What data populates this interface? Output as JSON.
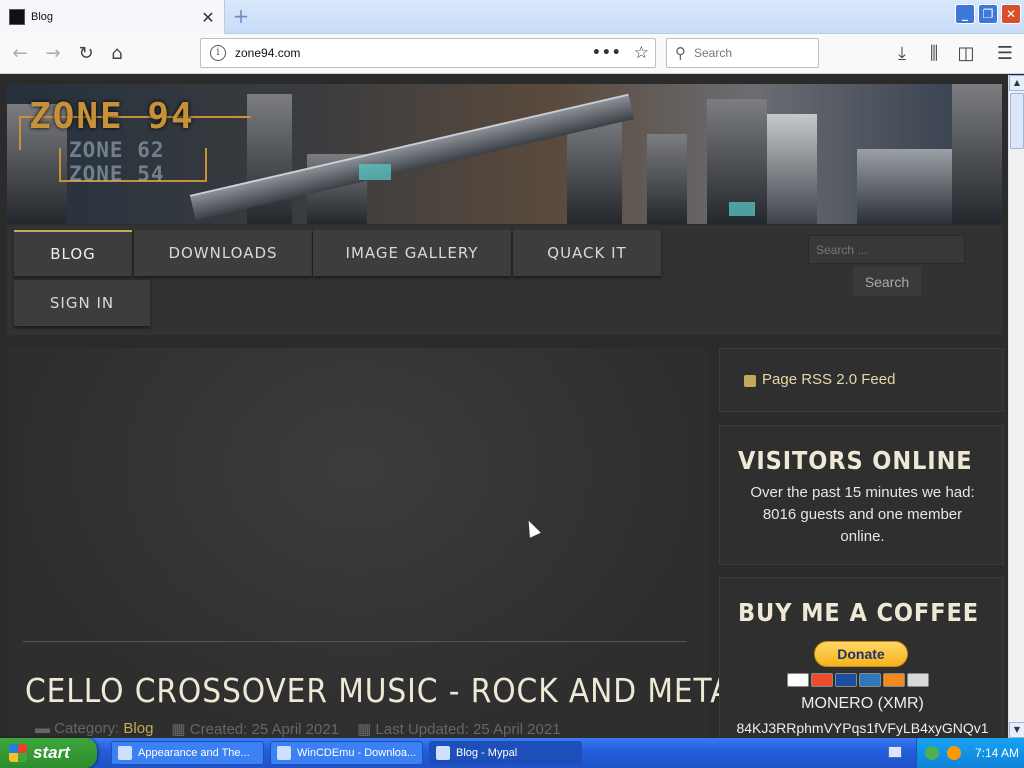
{
  "browser": {
    "tab_title": "Blog",
    "tab_close": "✕",
    "new_tab": "+",
    "url": "zone94.com",
    "url_info": "i",
    "search_placeholder": "Search",
    "window_min": "_",
    "window_max": "❐",
    "window_close": "✕"
  },
  "site": {
    "logo_main": "ZONE 94",
    "logo_sub1": "ZONE 62",
    "logo_sub2": "ZONE 54",
    "menu": {
      "blog": "BLOG",
      "downloads": "DOWNLOADS",
      "image_gallery": "IMAGE GALLERY",
      "quack_it": "QUACK IT",
      "sign_in": "SIGN IN"
    },
    "search_placeholder": "Search ...",
    "search_button": "Search"
  },
  "article": {
    "title": "CELLO CROSSOVER MUSIC - ROCK AND METAL",
    "category_label": "Category:",
    "category": "Blog",
    "created": "Created: 25 April 2021",
    "updated": "Last Updated: 25 April 2021"
  },
  "sidebar": {
    "rss": "Page RSS 2.0 Feed",
    "visitors_heading": "VISITORS ONLINE",
    "visitors_text": "Over the past 15 minutes we had: 8016 guests and one member online.",
    "coffee_heading": "BUY ME A COFFEE",
    "donate": "Donate",
    "monero_title": "MONERO (XMR)",
    "monero_address": "84KJ3RRphmVYPqs1fVFyLB4xyGNQv1"
  },
  "taskbar": {
    "start": "start",
    "tasks": [
      "Appearance and The...",
      "WinCDEmu - Downloa...",
      "Blog - Mypal"
    ],
    "clock": "7:14 AM"
  },
  "icons": {
    "back": "back-arrow-icon",
    "forward": "forward-arrow-icon",
    "reload": "reload-icon",
    "home": "home-icon",
    "download": "download-icon",
    "library": "library-icon",
    "sidebar": "sidebar-icon",
    "menu": "hamburger-menu-icon"
  },
  "colors": {
    "accent_gold": "#c4a95a",
    "page_bg": "#2b2b2b",
    "heading": "#eee8d4"
  }
}
